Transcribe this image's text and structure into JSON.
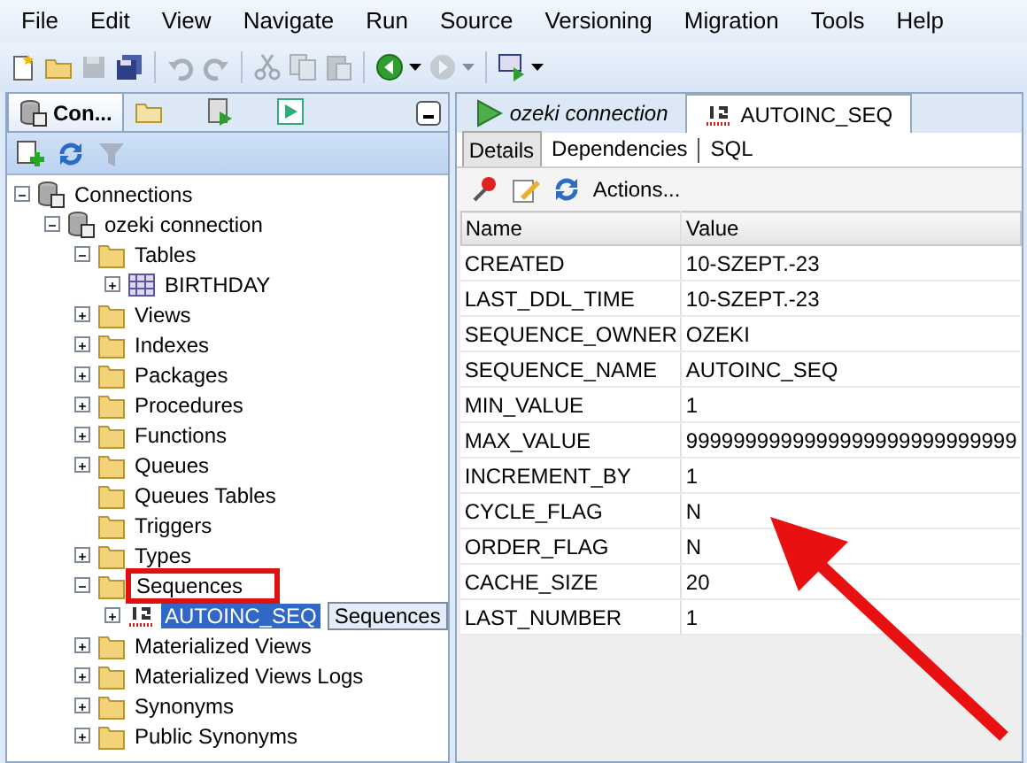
{
  "menu": [
    "File",
    "Edit",
    "View",
    "Navigate",
    "Run",
    "Source",
    "Versioning",
    "Migration",
    "Tools",
    "Help"
  ],
  "toolbar": [
    {
      "kind": "new",
      "disabled": false,
      "dropdown": false
    },
    {
      "kind": "open",
      "disabled": false,
      "dropdown": false
    },
    {
      "kind": "save",
      "disabled": true,
      "dropdown": false
    },
    {
      "kind": "save-all",
      "disabled": false,
      "dropdown": false
    },
    {
      "kind": "separator"
    },
    {
      "kind": "undo",
      "disabled": true,
      "dropdown": false
    },
    {
      "kind": "redo",
      "disabled": true,
      "dropdown": false
    },
    {
      "kind": "separator"
    },
    {
      "kind": "cut",
      "disabled": true,
      "dropdown": false
    },
    {
      "kind": "copy",
      "disabled": true,
      "dropdown": false
    },
    {
      "kind": "paste",
      "disabled": true,
      "dropdown": false
    },
    {
      "kind": "separator"
    },
    {
      "kind": "back",
      "disabled": false,
      "dropdown": true
    },
    {
      "kind": "forward",
      "disabled": true,
      "dropdown": true
    },
    {
      "kind": "separator"
    },
    {
      "kind": "sql",
      "disabled": false,
      "dropdown": true
    }
  ],
  "navigator": {
    "tabs": [
      {
        "kind": "connections",
        "label": "Con...",
        "selected": true
      },
      {
        "kind": "files",
        "selected": false
      },
      {
        "kind": "reports",
        "selected": false
      },
      {
        "kind": "snippets",
        "selected": false
      }
    ],
    "toolbar": [
      {
        "kind": "add",
        "disabled": false
      },
      {
        "kind": "refresh",
        "disabled": false
      },
      {
        "kind": "filter",
        "disabled": true
      }
    ],
    "tree": [
      {
        "label": "Connections",
        "kind": "connection",
        "expanded": true,
        "selected": false,
        "children": [
          {
            "label": "ozeki connection",
            "kind": "connection",
            "expanded": true,
            "selected": false,
            "children": [
              {
                "label": "Tables",
                "kind": "folder",
                "expanded": true,
                "selected": false,
                "children": [
                  {
                    "label": "BIRTHDAY",
                    "kind": "table",
                    "expanded": false,
                    "selected": false
                  }
                ]
              },
              {
                "label": "Views",
                "kind": "folder",
                "expanded": false,
                "selected": false
              },
              {
                "label": "Indexes",
                "kind": "folder",
                "expanded": false,
                "selected": false
              },
              {
                "label": "Packages",
                "kind": "folder",
                "expanded": false,
                "selected": false
              },
              {
                "label": "Procedures",
                "kind": "folder",
                "expanded": false,
                "selected": false
              },
              {
                "label": "Functions",
                "kind": "folder",
                "expanded": false,
                "selected": false
              },
              {
                "label": "Queues",
                "kind": "folder",
                "expanded": false,
                "selected": false
              },
              {
                "label": "Queues Tables",
                "kind": "folder",
                "selected": false
              },
              {
                "label": "Triggers",
                "kind": "folder",
                "selected": false
              },
              {
                "label": "Types",
                "kind": "folder",
                "expanded": false,
                "selected": false
              },
              {
                "label": "Sequences",
                "kind": "folder",
                "expanded": true,
                "selected": false,
                "marked": true,
                "children": [
                  {
                    "label": "AUTOINC_SEQ",
                    "kind": "sequence",
                    "expanded": false,
                    "selected": true,
                    "tooltip": "Sequences"
                  }
                ]
              },
              {
                "label": "Materialized Views",
                "kind": "folder",
                "expanded": false,
                "selected": false
              },
              {
                "label": "Materialized Views Logs",
                "kind": "folder",
                "expanded": false,
                "selected": false
              },
              {
                "label": "Synonyms",
                "kind": "folder",
                "expanded": false,
                "selected": false
              },
              {
                "label": "Public Synonyms",
                "kind": "folder",
                "expanded": false,
                "selected": false
              }
            ]
          }
        ]
      }
    ]
  },
  "editor": {
    "tabs": [
      {
        "kind": "connection",
        "label": "ozeki connection",
        "selected": false
      },
      {
        "kind": "sequence",
        "label": "AUTOINC_SEQ",
        "selected": true
      }
    ],
    "subtabs": [
      {
        "label": "Details",
        "selected": true
      },
      {
        "label": "Dependencies",
        "selected": false
      },
      {
        "label": "SQL",
        "selected": false
      }
    ],
    "toolbar": [
      {
        "kind": "pin"
      },
      {
        "kind": "edit"
      },
      {
        "kind": "refresh"
      }
    ],
    "actions_button": "Actions...",
    "table": {
      "columns": [
        "Name",
        "Value"
      ],
      "rows": [
        [
          "CREATED",
          "10-SZEPT.-23"
        ],
        [
          "LAST_DDL_TIME",
          "10-SZEPT.-23"
        ],
        [
          "SEQUENCE_OWNER",
          "OZEKI"
        ],
        [
          "SEQUENCE_NAME",
          "AUTOINC_SEQ"
        ],
        [
          "MIN_VALUE",
          "1"
        ],
        [
          "MAX_VALUE",
          "9999999999999999999999999999"
        ],
        [
          "INCREMENT_BY",
          "1"
        ],
        [
          "CYCLE_FLAG",
          "N"
        ],
        [
          "ORDER_FLAG",
          "N"
        ],
        [
          "CACHE_SIZE",
          "20"
        ],
        [
          "LAST_NUMBER",
          "1"
        ]
      ]
    }
  }
}
